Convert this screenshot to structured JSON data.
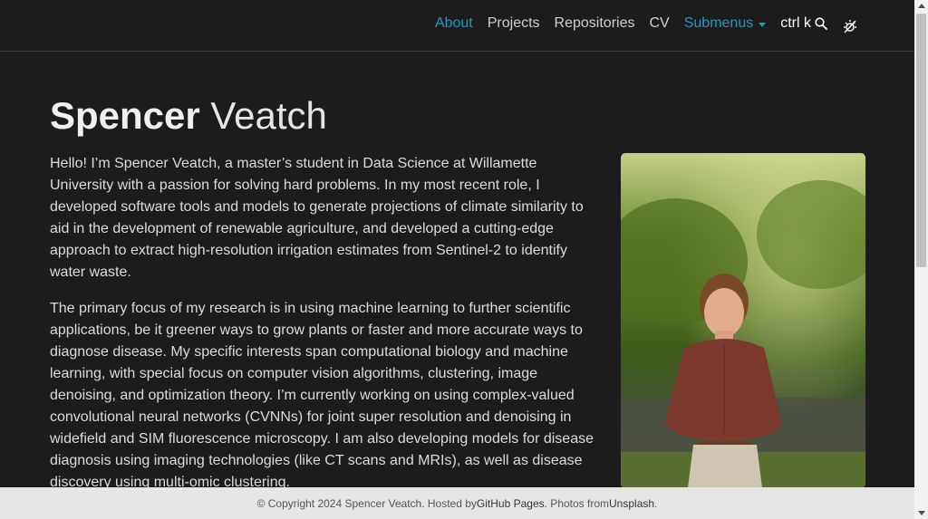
{
  "nav": {
    "items": [
      {
        "label": "About",
        "active": true
      },
      {
        "label": "Projects",
        "active": false
      },
      {
        "label": "Repositories",
        "active": false
      },
      {
        "label": "CV",
        "active": false
      }
    ],
    "submenus_label": "Submenus",
    "search_label": "ctrl k",
    "accent_color": "#2698ba"
  },
  "header": {
    "first_name": "Spencer",
    "last_name": "Veatch"
  },
  "bio": {
    "paragraphs": [
      "Hello! I’m Spencer Veatch, a master’s student in Data Science at Willamette University with a passion for solving hard problems. In my most recent role, I developed software tools and models to generate projections of climate similarity to aid in the development of renewable agriculture, and developed a cutting-edge approach to extract high-resolution irrigation estimates from Sentinel-2 to identify water waste.",
      "The primary focus of my research is in using machine learning to further scientific applications, be it greener ways to grow plants or faster and more accurate ways to diagnose disease. My specific interests span computational biology and machine learning, with special focus on computer vision algorithms, clustering, image denoising, and optimization theory. I’m currently working on using complex-valued convolutional neural networks (CVNNs) for joint super resolution and denoising in widefield and SIM fluorescence microscopy. I am also developing models for disease diagnosis using imaging technologies (like CT scans and MRIs), as well as disease discovery using multi-omic clustering."
    ]
  },
  "footer": {
    "prefix": "© Copyright 2024 Spencer Veatch. Hosted by ",
    "github": "GitHub Pages",
    "middle": ". Photos from ",
    "unsplash": "Unsplash",
    "suffix": "."
  }
}
